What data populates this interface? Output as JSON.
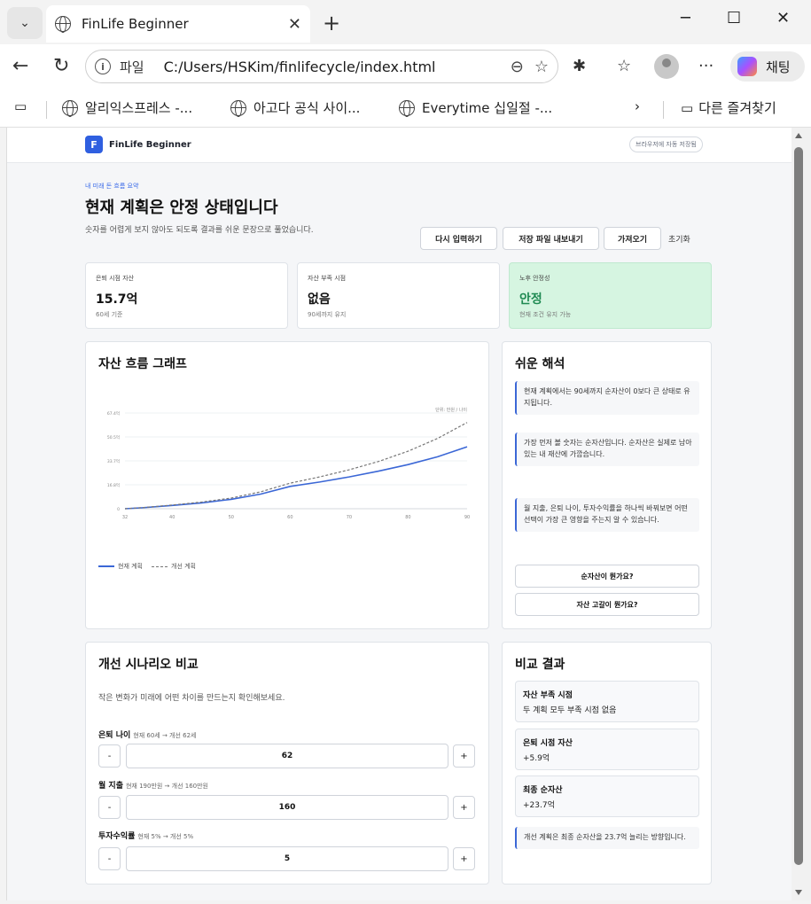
{
  "browser": {
    "tab_title": "FinLife Beginner",
    "address_label": "파일",
    "url": "C:/Users/HSKim/finlifecycle/index.html",
    "copilot_label": "채팅",
    "bookmarks": [
      "알리익스프레스 -...",
      "아고다 공식 사이...",
      "Everytime 십일절 -..."
    ],
    "other_favorites": "다른 즐겨찾기"
  },
  "header": {
    "brand_mark": "F",
    "brand_name": "FinLife Beginner",
    "autosave": "브라우저에 자동 저장됨"
  },
  "hero": {
    "eyebrow": "내 미래 돈 흐름 요약",
    "title": "현재 계획은 안정 상태입니다",
    "subtitle": "숫자를 어렵게 보지 않아도 되도록 결과를 쉬운 문장으로 풀었습니다.",
    "buttons": [
      "다시 입력하기",
      "저장 파일 내보내기",
      "가져오기"
    ],
    "reset": "초기화"
  },
  "kpis": [
    {
      "label": "은퇴 시점 자산",
      "value": "15.7억",
      "note": "60세 기준"
    },
    {
      "label": "자산 부족 시점",
      "value": "없음",
      "note": "90세까지 유지"
    },
    {
      "label": "노후 안정성",
      "value": "안정",
      "note": "현재 조건 유지 가능"
    }
  ],
  "chart_card": {
    "title": "자산 흐름 그래프",
    "unit_label": "단위: 만원 / 나이",
    "legend": [
      "현재 계획",
      "개선 계획"
    ]
  },
  "chart_data": {
    "type": "line",
    "x": [
      32,
      35,
      40,
      45,
      50,
      55,
      60,
      65,
      70,
      75,
      80,
      85,
      90
    ],
    "series": [
      {
        "name": "현재 계획",
        "values": [
          0,
          0.7,
          2.3,
          4.1,
          6.6,
          10.3,
          15.7,
          18.8,
          22.4,
          26.5,
          31.1,
          36.6,
          43.6
        ]
      },
      {
        "name": "개선 계획",
        "values": [
          0,
          0.8,
          2.6,
          4.7,
          7.5,
          11.9,
          18.0,
          22.4,
          27.4,
          33.3,
          40.5,
          49.5,
          60.7
        ]
      }
    ],
    "y_ticks": [
      "0",
      "16.8억",
      "33.7억",
      "50.5억",
      "67.4억"
    ],
    "x_ticks": [
      "32",
      "40",
      "50",
      "60",
      "70",
      "80",
      "90"
    ],
    "ylim": [
      0,
      67.4
    ],
    "xlim": [
      32,
      90
    ],
    "grid": true,
    "legend_position": "bottom-left"
  },
  "interpretation": {
    "title": "쉬운 해석",
    "items": [
      "현재 계획에서는 90세까지 순자산이 0보다 큰 상태로 유지됩니다.",
      "가장 먼저 볼 숫자는 순자산입니다. 순자산은 실제로 남아 있는 내 재산에 가깝습니다.",
      "월 지출, 은퇴 나이, 투자수익률을 하나씩 바꿔보면 어떤 선택이 가장 큰 영향을 주는지 알 수 있습니다."
    ],
    "questions": [
      "순자산이 뭔가요?",
      "자산 고갈이 뭔가요?"
    ]
  },
  "scenario": {
    "title": "개선 시나리오 비교",
    "desc": "작은 변화가 미래에 어떤 차이를 만드는지 확인해보세요.",
    "rows": [
      {
        "label": "은퇴 나이",
        "hint": "현재 60세 → 개선 62세",
        "value": "62"
      },
      {
        "label": "월 지출",
        "hint": "현재 190만원 → 개선 160만원",
        "value": "160"
      },
      {
        "label": "투자수익률",
        "hint": "현재 5% → 개선 5%",
        "value": "5"
      }
    ],
    "minus": "-",
    "plus": "+"
  },
  "compare": {
    "title": "비교 결과",
    "items": [
      {
        "title": "자산 부족 시점",
        "desc": "두 계획 모두 부족 시점 없음"
      },
      {
        "title": "은퇴 시점 자산",
        "desc": "+5.9억"
      },
      {
        "title": "최종 순자산",
        "desc": "+23.7억"
      }
    ],
    "summary": "개선 계획은 최종 순자산을 23.7억 늘리는 방향입니다."
  }
}
